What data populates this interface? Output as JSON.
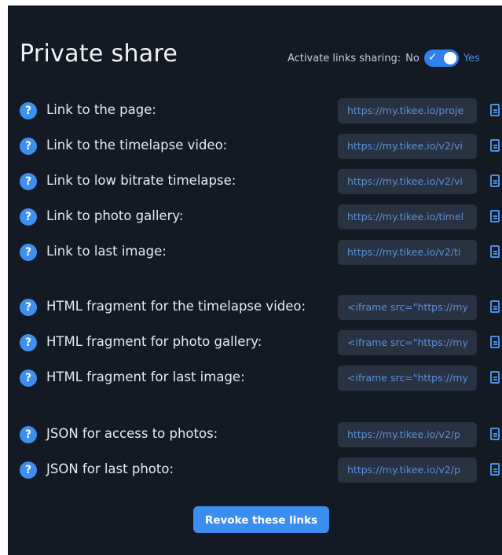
{
  "header": {
    "title": "Private share",
    "sharing_label": "Activate links sharing:",
    "no_label": "No",
    "yes_label": "Yes",
    "sharing_enabled": true
  },
  "links": [
    {
      "label": "Link to the page:",
      "value": "https://my.tikee.io/proje"
    },
    {
      "label": "Link to the timelapse video:",
      "value": "https://my.tikee.io/v2/vi"
    },
    {
      "label": "Link to low bitrate timelapse:",
      "value": "https://my.tikee.io/v2/vi"
    },
    {
      "label": "Link to photo gallery:",
      "value": "https://my.tikee.io/timel"
    },
    {
      "label": "Link to last image:",
      "value": "https://my.tikee.io/v2/ti"
    },
    {
      "label": "HTML fragment for the timelapse video:",
      "value": "<iframe src=\"https://my"
    },
    {
      "label": "HTML fragment for photo gallery:",
      "value": "<iframe src=\"https://my"
    },
    {
      "label": "HTML fragment for last image:",
      "value": "<iframe src=\"https://my"
    },
    {
      "label": "JSON for access to photos:",
      "value": "https://my.tikee.io/v2/p"
    },
    {
      "label": "JSON for last photo:",
      "value": "https://my.tikee.io/v2/p"
    }
  ],
  "help_glyph": "?",
  "icons": {
    "help": "question-circle-icon",
    "copy": "copy-document-icon",
    "toggle_check": "checkmark-icon"
  },
  "colors": {
    "background": "#141a24",
    "accent": "#3b8ef0",
    "field_bg": "#283241",
    "field_text": "#5a8fd8"
  },
  "footer": {
    "revoke_label": "Revoke these links"
  }
}
